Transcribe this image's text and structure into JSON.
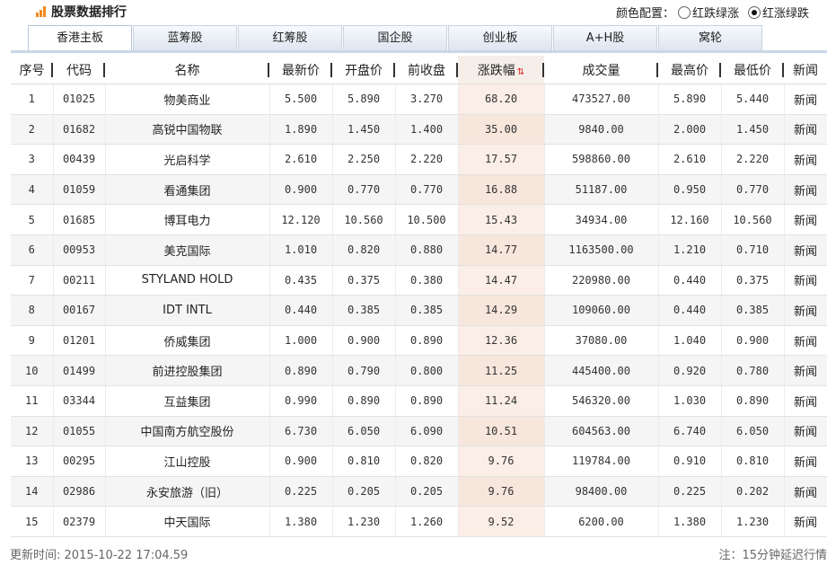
{
  "header": {
    "title": "股票数据排行",
    "color_config_label": "颜色配置：",
    "option_green_up": "红跌绿涨",
    "option_red_up": "红涨绿跌",
    "selected_option": "红涨绿跌"
  },
  "tabs": [
    {
      "label": "香港主板",
      "active": true
    },
    {
      "label": "蓝筹股",
      "active": false
    },
    {
      "label": "红筹股",
      "active": false
    },
    {
      "label": "国企股",
      "active": false
    },
    {
      "label": "创业板",
      "active": false
    },
    {
      "label": "A+H股",
      "active": false
    },
    {
      "label": "窝轮",
      "active": false
    }
  ],
  "table": {
    "columns": [
      "序号",
      "代码",
      "名称",
      "最新价",
      "开盘价",
      "前收盘",
      "涨跌幅",
      "成交量",
      "最高价",
      "最低价",
      "新闻"
    ],
    "sorted_column": "涨跌幅",
    "sort_direction": "desc",
    "rows": [
      {
        "no": "1",
        "code": "01025",
        "name": "物美商业",
        "latest": "5.500",
        "open": "5.890",
        "prev_close": "3.270",
        "change_pct": "68.20",
        "volume": "473527.00",
        "high": "5.890",
        "low": "5.440",
        "news": "新闻"
      },
      {
        "no": "2",
        "code": "01682",
        "name": "高锐中国物联",
        "latest": "1.890",
        "open": "1.450",
        "prev_close": "1.400",
        "change_pct": "35.00",
        "volume": "9840.00",
        "high": "2.000",
        "low": "1.450",
        "news": "新闻"
      },
      {
        "no": "3",
        "code": "00439",
        "name": "光启科学",
        "latest": "2.610",
        "open": "2.250",
        "prev_close": "2.220",
        "change_pct": "17.57",
        "volume": "598860.00",
        "high": "2.610",
        "low": "2.220",
        "news": "新闻"
      },
      {
        "no": "4",
        "code": "01059",
        "name": "看通集团",
        "latest": "0.900",
        "open": "0.770",
        "prev_close": "0.770",
        "change_pct": "16.88",
        "volume": "51187.00",
        "high": "0.950",
        "low": "0.770",
        "news": "新闻"
      },
      {
        "no": "5",
        "code": "01685",
        "name": "博耳电力",
        "latest": "12.120",
        "open": "10.560",
        "prev_close": "10.500",
        "change_pct": "15.43",
        "volume": "34934.00",
        "high": "12.160",
        "low": "10.560",
        "news": "新闻"
      },
      {
        "no": "6",
        "code": "00953",
        "name": "美克国际",
        "latest": "1.010",
        "open": "0.820",
        "prev_close": "0.880",
        "change_pct": "14.77",
        "volume": "1163500.00",
        "high": "1.210",
        "low": "0.710",
        "news": "新闻"
      },
      {
        "no": "7",
        "code": "00211",
        "name": "STYLAND HOLD",
        "latest": "0.435",
        "open": "0.375",
        "prev_close": "0.380",
        "change_pct": "14.47",
        "volume": "220980.00",
        "high": "0.440",
        "low": "0.375",
        "news": "新闻"
      },
      {
        "no": "8",
        "code": "00167",
        "name": "IDT INTL",
        "latest": "0.440",
        "open": "0.385",
        "prev_close": "0.385",
        "change_pct": "14.29",
        "volume": "109060.00",
        "high": "0.440",
        "low": "0.385",
        "news": "新闻"
      },
      {
        "no": "9",
        "code": "01201",
        "name": "侨威集团",
        "latest": "1.000",
        "open": "0.900",
        "prev_close": "0.890",
        "change_pct": "12.36",
        "volume": "37080.00",
        "high": "1.040",
        "low": "0.900",
        "news": "新闻"
      },
      {
        "no": "10",
        "code": "01499",
        "name": "前进控股集团",
        "latest": "0.890",
        "open": "0.790",
        "prev_close": "0.800",
        "change_pct": "11.25",
        "volume": "445400.00",
        "high": "0.920",
        "low": "0.780",
        "news": "新闻"
      },
      {
        "no": "11",
        "code": "03344",
        "name": "互益集团",
        "latest": "0.990",
        "open": "0.890",
        "prev_close": "0.890",
        "change_pct": "11.24",
        "volume": "546320.00",
        "high": "1.030",
        "low": "0.890",
        "news": "新闻"
      },
      {
        "no": "12",
        "code": "01055",
        "name": "中国南方航空股份",
        "latest": "6.730",
        "open": "6.050",
        "prev_close": "6.090",
        "change_pct": "10.51",
        "volume": "604563.00",
        "high": "6.740",
        "low": "6.050",
        "news": "新闻"
      },
      {
        "no": "13",
        "code": "00295",
        "name": "江山控股",
        "latest": "0.900",
        "open": "0.810",
        "prev_close": "0.820",
        "change_pct": "9.76",
        "volume": "119784.00",
        "high": "0.910",
        "low": "0.810",
        "news": "新闻"
      },
      {
        "no": "14",
        "code": "02986",
        "name": "永安旅游（旧）",
        "latest": "0.225",
        "open": "0.205",
        "prev_close": "0.205",
        "change_pct": "9.76",
        "volume": "98400.00",
        "high": "0.225",
        "low": "0.202",
        "news": "新闻"
      },
      {
        "no": "15",
        "code": "02379",
        "name": "中天国际",
        "latest": "1.380",
        "open": "1.230",
        "prev_close": "1.260",
        "change_pct": "9.52",
        "volume": "6200.00",
        "high": "1.380",
        "low": "1.230",
        "news": "新闻"
      }
    ]
  },
  "footer": {
    "update_time": "更新时间: 2015-10-22 17:04.59",
    "note": "注：15分钟延迟行情"
  },
  "colors": {
    "up": "#e23b3b",
    "down": "#1f8f1f",
    "flat": "#333333",
    "accent": "#f08a1f"
  }
}
